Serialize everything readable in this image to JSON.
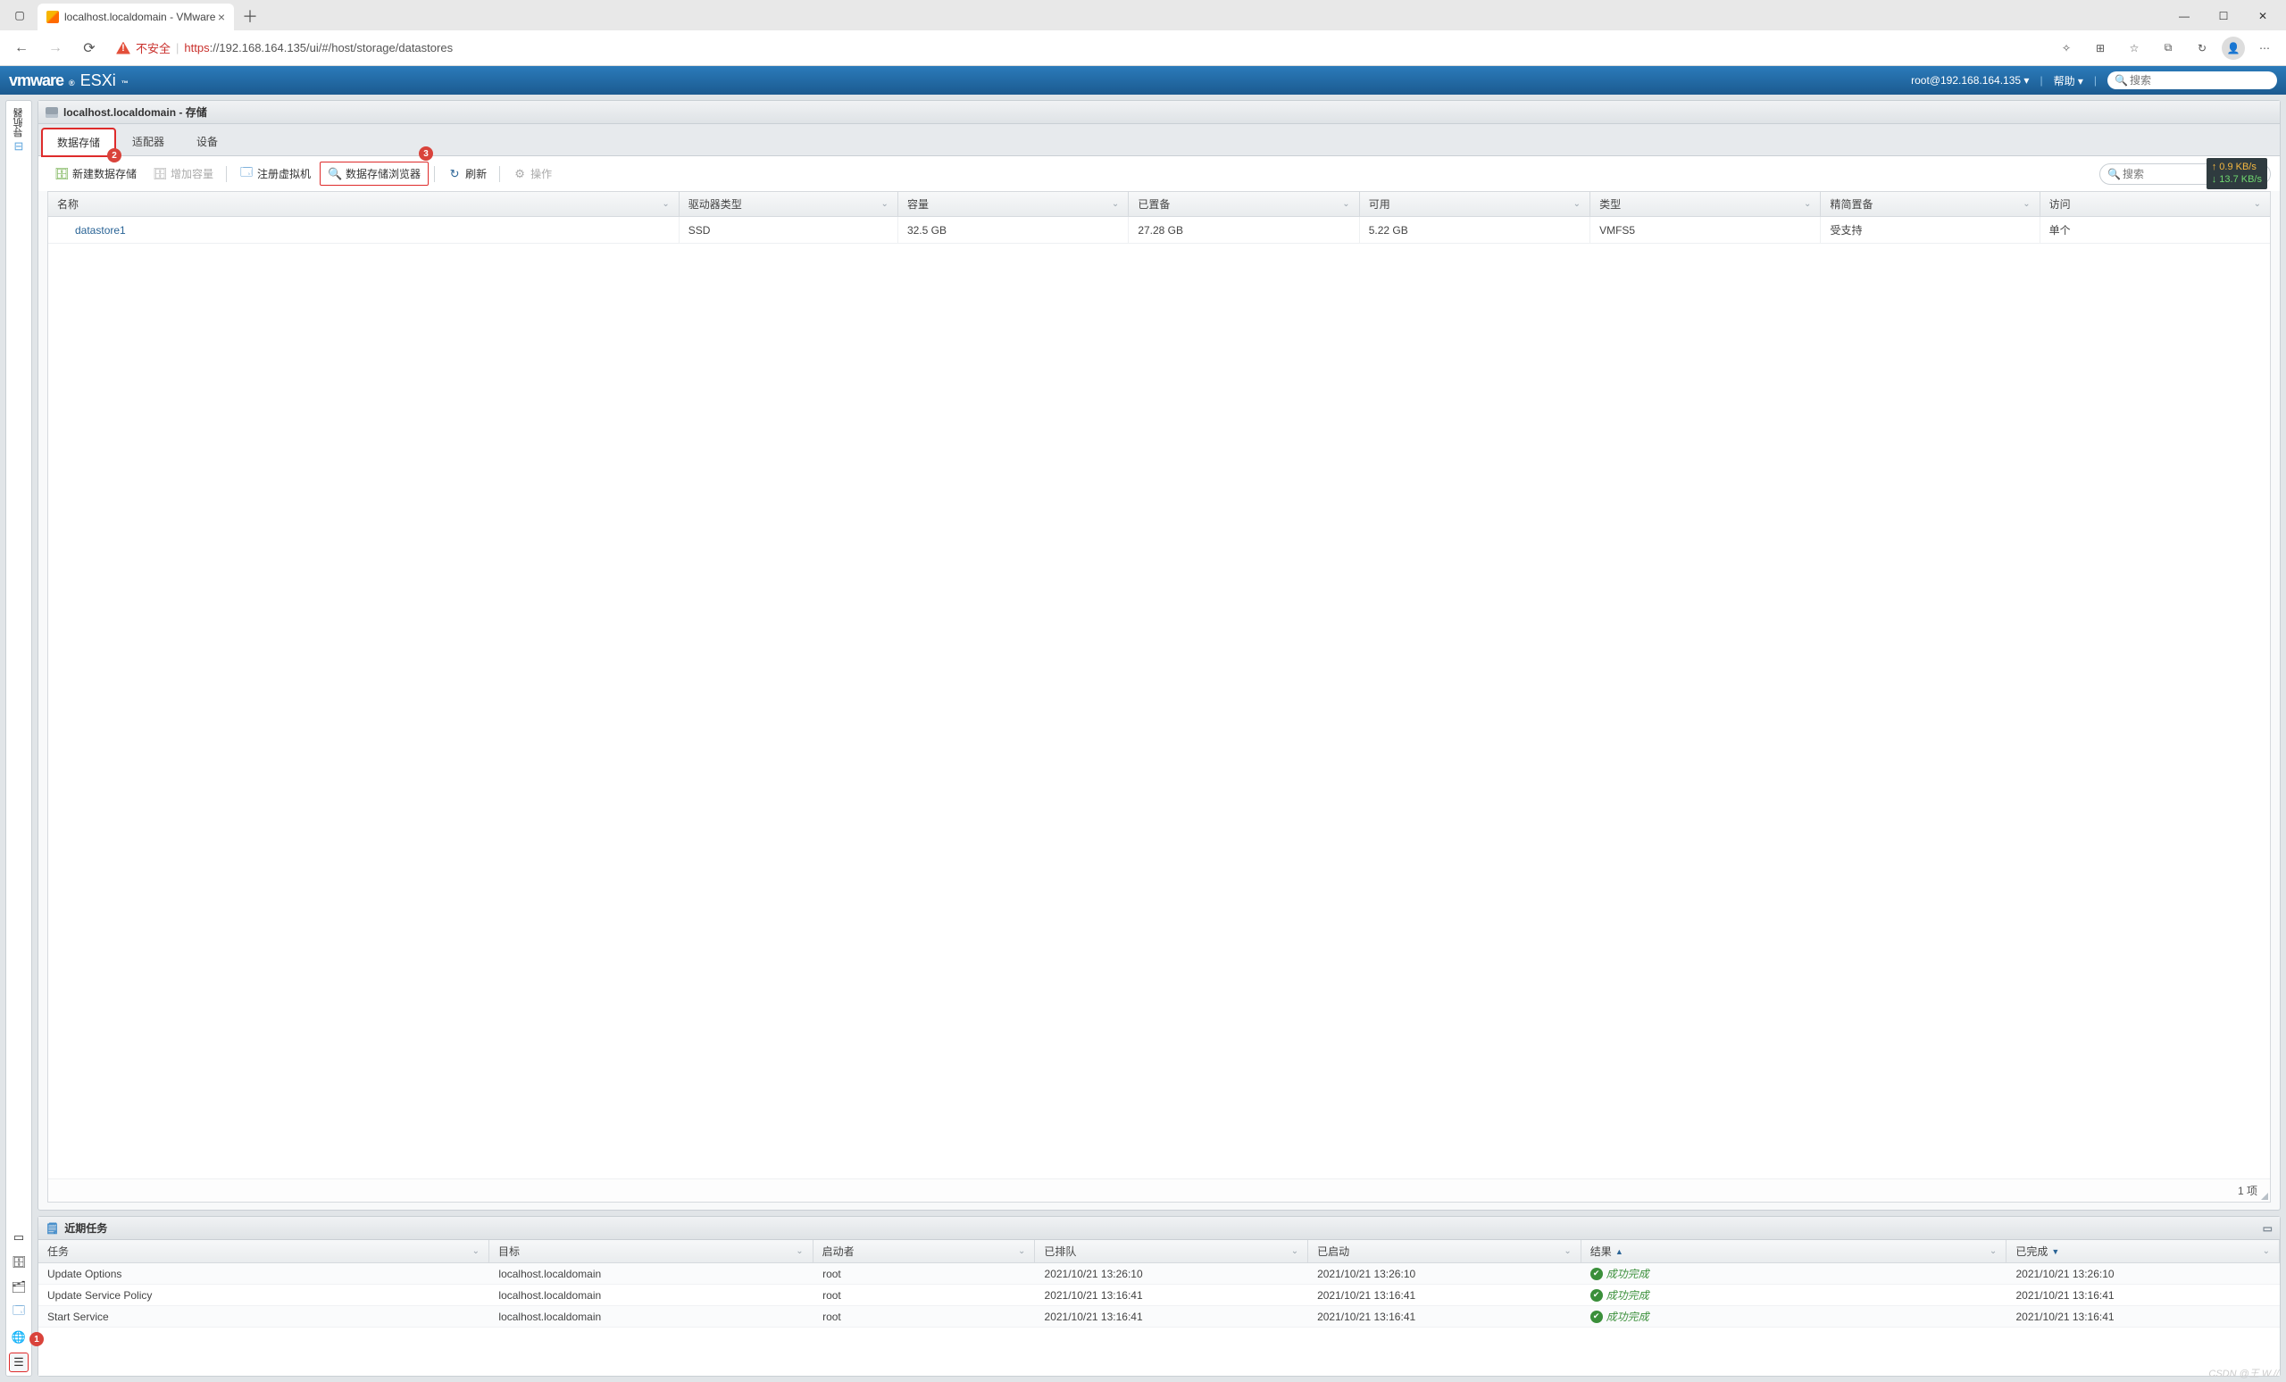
{
  "browser": {
    "tab_title": "localhost.localdomain - VMware",
    "url_insecure_label": "不安全",
    "url_https": "https",
    "url_rest": "://192.168.164.135/ui/#/host/storage/datastores",
    "window": {
      "min": "—",
      "max": "☐",
      "close": "✕"
    }
  },
  "header": {
    "logo_vm": "vmware",
    "logo_reg": "®",
    "logo_esxi": "ESXi",
    "user": "root@192.168.164.135 ▾",
    "help": "帮助 ▾",
    "search_placeholder": "搜索"
  },
  "sidebar": {
    "nav_label": "导航器",
    "annot1": "1"
  },
  "panel": {
    "title": "localhost.localdomain - 存储",
    "tabs": {
      "datastores": "数据存储",
      "adapters": "适配器",
      "devices": "设备",
      "annot2": "2",
      "annot3": "3"
    },
    "toolbar": {
      "new_ds": "新建数据存储",
      "increase": "增加容量",
      "register_vm": "注册虚拟机",
      "ds_browser": "数据存储浏览器",
      "refresh": "刷新",
      "actions": "操作",
      "search_placeholder": "搜索"
    },
    "net": {
      "up": "↑ 0.9 KB/s",
      "down": "↓ 13.7 KB/s"
    },
    "grid": {
      "headers": {
        "name": "名称",
        "drive": "驱动器类型",
        "cap": "容量",
        "alloc": "已置备",
        "free": "可用",
        "type": "类型",
        "thin": "精简置备",
        "access": "访问"
      },
      "row": {
        "name": "datastore1",
        "drive": "SSD",
        "cap": "32.5 GB",
        "alloc": "27.28 GB",
        "free": "5.22 GB",
        "type": "VMFS5",
        "thin": "受支持",
        "access": "单个"
      },
      "footer": "1 项"
    }
  },
  "tasks": {
    "title": "近期任务",
    "headers": {
      "task": "任务",
      "target": "目标",
      "initiator": "启动者",
      "queued": "已排队",
      "started": "已启动",
      "result": "结果",
      "completed": "已完成"
    },
    "sort_up": "▲",
    "sort_dn": "▼",
    "rows": [
      {
        "task": "Update Options",
        "target": "localhost.localdomain",
        "initiator": "root",
        "queued": "2021/10/21 13:26:10",
        "started": "2021/10/21 13:26:10",
        "result": "成功完成",
        "completed": "2021/10/21 13:26:10"
      },
      {
        "task": "Update Service Policy",
        "target": "localhost.localdomain",
        "initiator": "root",
        "queued": "2021/10/21 13:16:41",
        "started": "2021/10/21 13:16:41",
        "result": "成功完成",
        "completed": "2021/10/21 13:16:41"
      },
      {
        "task": "Start Service",
        "target": "localhost.localdomain",
        "initiator": "root",
        "queued": "2021/10/21 13:16:41",
        "started": "2021/10/21 13:16:41",
        "result": "成功完成",
        "completed": "2021/10/21 13:16:41"
      }
    ]
  },
  "watermark": "CSDN @王 W.//"
}
